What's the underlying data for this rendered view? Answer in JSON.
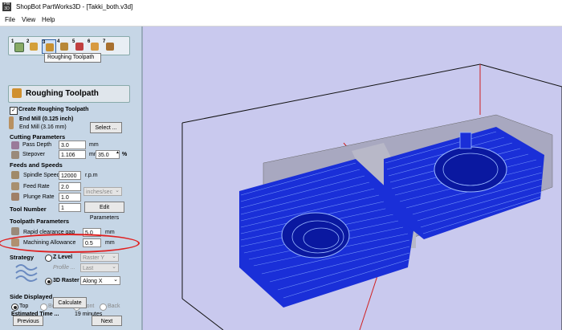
{
  "window": {
    "icon_text": "PW\n3D",
    "title": "ShopBot PartWorks3D - [Takki_both.v3d]"
  },
  "menu": {
    "file": "File",
    "view": "View",
    "help": "Help"
  },
  "toolbar": {
    "buttons": [
      {
        "num": "1",
        "icon": "material-setup-icon"
      },
      {
        "num": "2",
        "icon": "model-icon"
      },
      {
        "num": "3",
        "icon": "roughing-toolpath-icon"
      },
      {
        "num": "4",
        "icon": "finishing-toolpath-icon"
      },
      {
        "num": "5",
        "icon": "cutout-toolpath-icon"
      },
      {
        "num": "6",
        "icon": "preview-icon"
      },
      {
        "num": "7",
        "icon": "save-toolpath-icon"
      }
    ],
    "tooltip": "Roughing Toolpath",
    "colors": {
      "selected_border": "#3060a0"
    }
  },
  "panel": {
    "section_num": "3",
    "section_title": "Roughing Toolpath",
    "create_checkbox": "Create Roughing Toolpath",
    "tool_name": "End Mill (0.125 inch)",
    "tool_desc": "End Mill (3.16 mm)",
    "select_button": "Select ...",
    "cutting_params_heading": "Cutting Parameters",
    "pass_depth_label": "Pass Depth",
    "pass_depth_value": "3.0",
    "pass_depth_unit": "mm",
    "stepover_label": "Stepover",
    "stepover_value": "1.106",
    "stepover_unit": "mm",
    "stepover_percent": "35.0",
    "percent_sign": "%",
    "feeds_heading": "Feeds and Speeds",
    "spindle_label": "Spindle Speed",
    "spindle_value": "12000",
    "spindle_unit": "r.p.m",
    "feed_label": "Feed Rate",
    "feed_value": "2.0",
    "feed_unit_select": "inches/sec",
    "plunge_label": "Plunge Rate",
    "plunge_value": "1.0",
    "tool_number_label": "Tool Number",
    "tool_number_value": "1",
    "edit_params_button": "Edit Parameters",
    "toolpath_params_heading": "Toolpath Parameters",
    "rapid_label": "Rapid clearance gap",
    "rapid_value": "5.0",
    "rapid_unit": "mm",
    "allowance_label": "Machining Allowance",
    "allowance_value": "0.5",
    "allowance_unit": "mm",
    "strategy_label": "Strategy",
    "zlevel_label": "Z Level",
    "zlevel_select": "Raster Y",
    "profile_label": "Profile ...",
    "profile_select": "Last",
    "raster3d_label": "3D Raster",
    "raster3d_select": "Along X",
    "side_heading": "Side Displayed ...",
    "side_top": "Top",
    "side_bottom": "Bottom",
    "side_front": "Front",
    "side_back": "Back",
    "est_time_label": "Estimated Time ...",
    "est_time_value": "19 minutes",
    "calculate_button": "Calculate",
    "previous_button": "Previous",
    "next_button": "Next"
  },
  "colors": {
    "panel_bg": "#c6d6e6",
    "viewport_bg": "#c9c9ee",
    "toolpath_blue": "#1a2fd8",
    "highlight_ellipse": "#e02020",
    "box_red": "#d02020"
  }
}
